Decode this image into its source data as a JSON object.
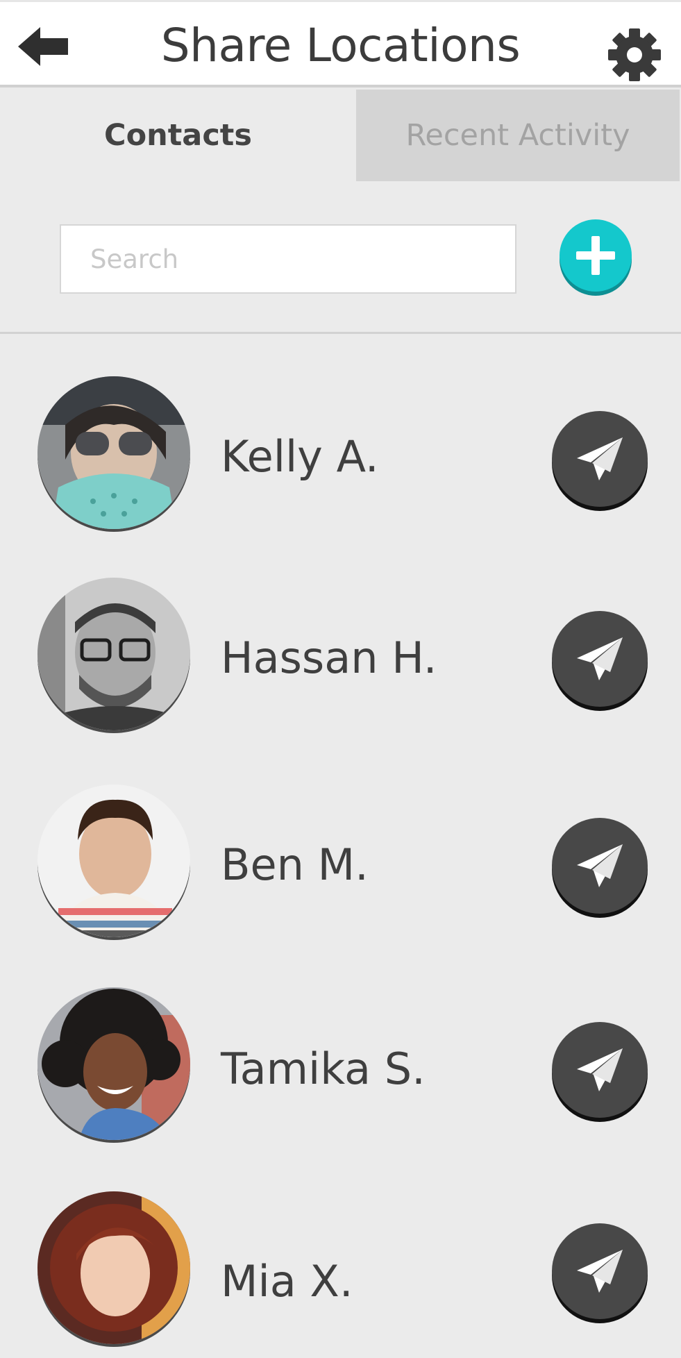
{
  "header": {
    "title": "Share Locations",
    "back_icon": "back-arrow-icon",
    "settings_icon": "gear-icon"
  },
  "tabs": [
    {
      "label": "Contacts",
      "active": true
    },
    {
      "label": "Recent Activity",
      "active": false
    }
  ],
  "search": {
    "placeholder": "Search",
    "value": ""
  },
  "add_button": {
    "icon": "plus-icon",
    "color": "#14c8cc"
  },
  "contacts": [
    {
      "name": "Kelly A.",
      "action_icon": "paper-plane-icon"
    },
    {
      "name": "Hassan H.",
      "action_icon": "paper-plane-icon"
    },
    {
      "name": "Ben M.",
      "action_icon": "paper-plane-icon"
    },
    {
      "name": "Tamika S.",
      "action_icon": "paper-plane-icon"
    },
    {
      "name": "Mia X.",
      "action_icon": "paper-plane-icon"
    }
  ],
  "colors": {
    "background": "#ebebeb",
    "accent": "#14c8cc",
    "send_button": "#484848",
    "inactive_tab": "#d4d4d4"
  }
}
